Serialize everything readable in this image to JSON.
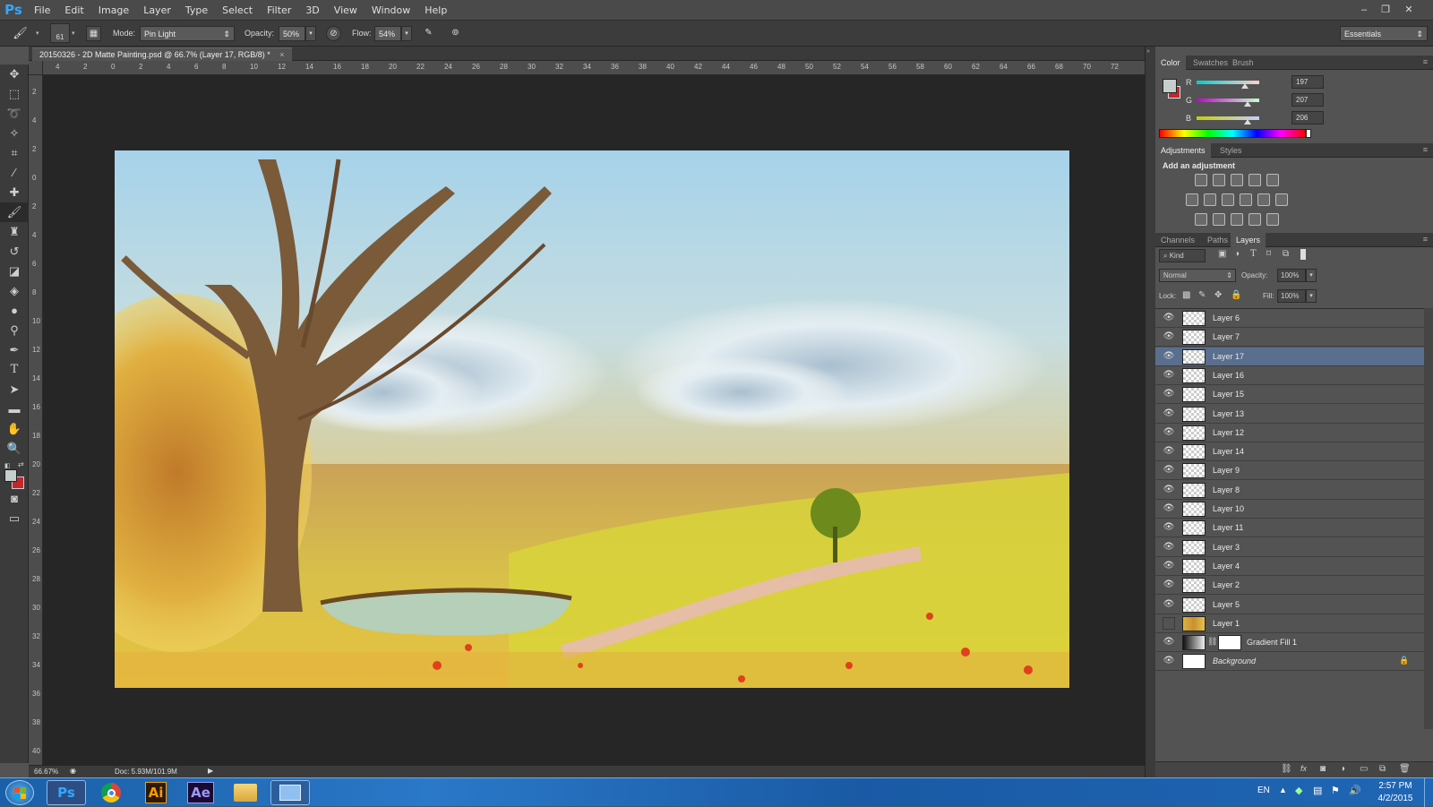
{
  "app": {
    "logo": "Ps"
  },
  "menu": [
    "File",
    "Edit",
    "Image",
    "Layer",
    "Type",
    "Select",
    "Filter",
    "3D",
    "View",
    "Window",
    "Help"
  ],
  "window_controls": {
    "minimize": "–",
    "restore": "❐",
    "close": "✕"
  },
  "options_bar": {
    "brush_size": "61",
    "mode_label": "Mode:",
    "mode_value": "Pin Light",
    "opacity_label": "Opacity:",
    "opacity_value": "50%",
    "flow_label": "Flow:",
    "flow_value": "54%",
    "workspace": "Essentials"
  },
  "document": {
    "tab_title": "20150326 - 2D Matte Painting.psd @ 66.7% (Layer 17, RGB/8) *",
    "close": "×"
  },
  "ruler": {
    "top_labels": [
      "4",
      "2",
      "0",
      "2",
      "4",
      "6",
      "8",
      "10",
      "12",
      "14",
      "16",
      "18",
      "20",
      "22",
      "24",
      "26",
      "28",
      "30",
      "32",
      "34",
      "36",
      "38",
      "40",
      "42",
      "44",
      "46",
      "48",
      "50",
      "52",
      "54",
      "56",
      "58",
      "60",
      "62",
      "64",
      "66",
      "68",
      "70",
      "72"
    ],
    "left_labels": [
      "2",
      "4",
      "2",
      "0",
      "2",
      "4",
      "6",
      "8",
      "10",
      "12",
      "14",
      "16",
      "18",
      "20",
      "22",
      "24",
      "26",
      "28",
      "30",
      "32",
      "34",
      "36",
      "38",
      "40"
    ]
  },
  "status": {
    "zoom": "66.67%",
    "doc": "Doc: 5.93M/101.9M"
  },
  "color_panel": {
    "tabs": [
      "Color",
      "Swatches",
      "Brush"
    ],
    "channels": [
      {
        "label": "R",
        "value": "197",
        "level": 0.77
      },
      {
        "label": "G",
        "value": "207",
        "level": 0.81
      },
      {
        "label": "B",
        "value": "206",
        "level": 0.81
      }
    ],
    "foreground": "#c5cfce",
    "background_color": "#c1272d"
  },
  "adjustments_panel": {
    "tabs": [
      "Adjustments",
      "Styles"
    ],
    "heading": "Add an adjustment"
  },
  "layers_panel": {
    "tabs": [
      "Channels",
      "Paths",
      "Layers"
    ],
    "filter_kind": "Kind",
    "blend_mode": "Normal",
    "opacity_label": "Opacity:",
    "opacity_value": "100%",
    "lock_label": "Lock:",
    "fill_label": "Fill:",
    "fill_value": "100%",
    "layers": [
      {
        "name": "Layer 6",
        "visible": true,
        "selected": false
      },
      {
        "name": "Layer 7",
        "visible": true,
        "selected": false
      },
      {
        "name": "Layer 17",
        "visible": true,
        "selected": true
      },
      {
        "name": "Layer 16",
        "visible": true,
        "selected": false
      },
      {
        "name": "Layer 15",
        "visible": true,
        "selected": false
      },
      {
        "name": "Layer 13",
        "visible": true,
        "selected": false
      },
      {
        "name": "Layer 12",
        "visible": true,
        "selected": false
      },
      {
        "name": "Layer 14",
        "visible": true,
        "selected": false
      },
      {
        "name": "Layer 9",
        "visible": true,
        "selected": false
      },
      {
        "name": "Layer 8",
        "visible": true,
        "selected": false
      },
      {
        "name": "Layer 10",
        "visible": true,
        "selected": false
      },
      {
        "name": "Layer 11",
        "visible": true,
        "selected": false
      },
      {
        "name": "Layer 3",
        "visible": true,
        "selected": false
      },
      {
        "name": "Layer 4",
        "visible": true,
        "selected": false
      },
      {
        "name": "Layer 2",
        "visible": true,
        "selected": false
      },
      {
        "name": "Layer 5",
        "visible": true,
        "selected": false
      },
      {
        "name": "Layer 1",
        "visible": false,
        "selected": false
      },
      {
        "name": "Gradient Fill 1",
        "visible": true,
        "selected": false
      },
      {
        "name": "Background",
        "visible": true,
        "selected": false
      }
    ]
  },
  "taskbar": {
    "apps": [
      "Ps",
      "",
      "Ai",
      "Ae",
      "",
      ""
    ],
    "language": "EN",
    "time": "2:57 PM",
    "date": "4/2/2015"
  }
}
